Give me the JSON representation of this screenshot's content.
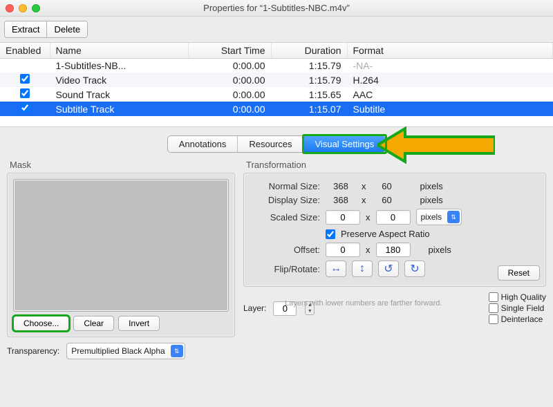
{
  "window": {
    "title": "Properties for “1-Subtitles-NBC.m4v”"
  },
  "toolbar": {
    "extract": "Extract",
    "delete": "Delete"
  },
  "table": {
    "headers": {
      "enabled": "Enabled",
      "name": "Name",
      "start": "Start Time",
      "duration": "Duration",
      "format": "Format"
    },
    "rows": [
      {
        "enabled": false,
        "name": "1-Subtitles-NB...",
        "start": "0:00.00",
        "duration": "1:15.79",
        "format": "-NA-",
        "selected": false
      },
      {
        "enabled": true,
        "name": "Video Track",
        "start": "0:00.00",
        "duration": "1:15.79",
        "format": "H.264",
        "selected": false
      },
      {
        "enabled": true,
        "name": "Sound Track",
        "start": "0:00.00",
        "duration": "1:15.65",
        "format": "AAC",
        "selected": false
      },
      {
        "enabled": true,
        "name": "Subtitle Track",
        "start": "0:00.00",
        "duration": "1:15.07",
        "format": "Subtitle",
        "selected": true
      }
    ]
  },
  "tabs": {
    "a": "Annotations",
    "b": "Resources",
    "c": "Visual Settings",
    "active": "c"
  },
  "mask": {
    "label": "Mask",
    "choose": "Choose...",
    "clear": "Clear",
    "invert": "Invert",
    "transparency_label": "Transparency:",
    "transparency_value": "Premultiplied Black Alpha"
  },
  "trf": {
    "label": "Transformation",
    "normal": "Normal Size:",
    "normal_w": "368",
    "normal_h": "60",
    "display": "Display Size:",
    "display_w": "368",
    "display_h": "60",
    "scaled": "Scaled Size:",
    "scaled_w": "0",
    "scaled_h": "0",
    "scaled_unit": "pixels",
    "preserve": "Preserve Aspect Ratio",
    "offset": "Offset:",
    "offset_x": "0",
    "offset_y": "180",
    "flip": "Flip/Rotate:",
    "pixels": "pixels",
    "x": "x",
    "reset": "Reset"
  },
  "footer": {
    "layer_label": "Layer:",
    "layer_value": "0",
    "hint": "Layers with lower numbers are farther forward.",
    "hq": "High Quality",
    "sf": "Single Field",
    "di": "Deinterlace"
  }
}
